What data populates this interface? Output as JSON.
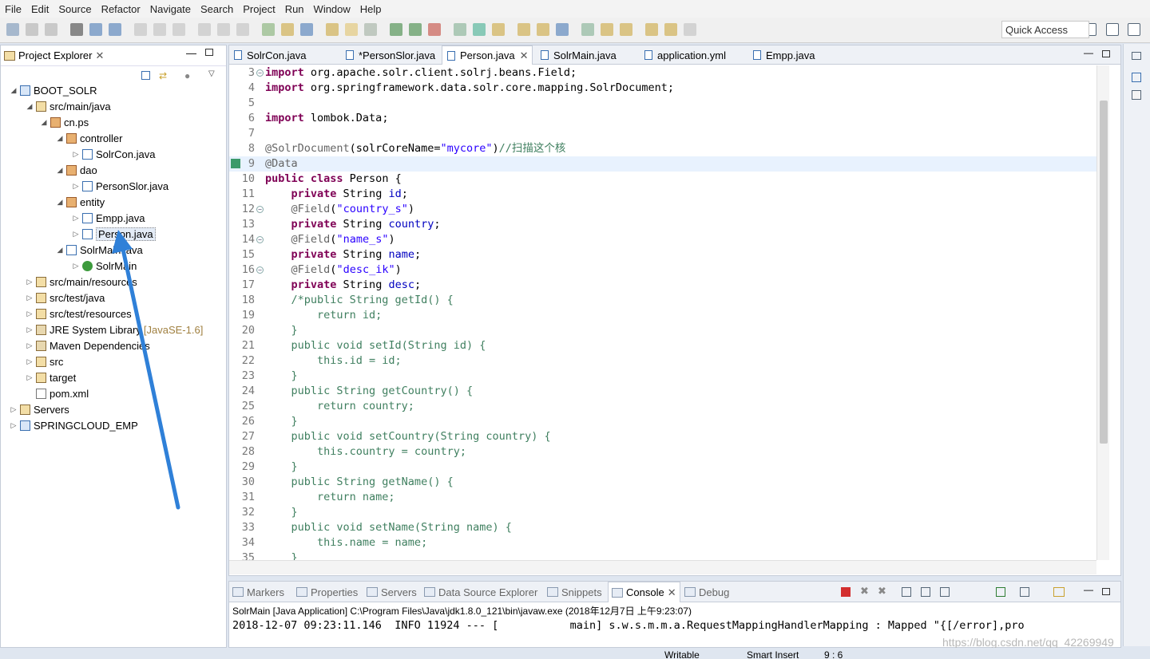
{
  "menu": [
    "File",
    "Edit",
    "Source",
    "Refactor",
    "Navigate",
    "Search",
    "Project",
    "Run",
    "Window",
    "Help"
  ],
  "toolbar": {
    "quick_access": "Quick Access"
  },
  "project_explorer": {
    "title": "Project Explorer",
    "tree": [
      {
        "label": "BOOT_SOLR",
        "icon": "project-icon",
        "twisty": "◢"
      },
      {
        "label": "src/main/java",
        "icon": "source-folder-icon",
        "twisty": "◢"
      },
      {
        "label": "cn.ps",
        "icon": "package-icon",
        "twisty": "◢"
      },
      {
        "label": "controller",
        "icon": "package-icon",
        "twisty": "◢"
      },
      {
        "label": "SolrCon.java",
        "icon": "java-file-icon",
        "twisty": "▷"
      },
      {
        "label": "dao",
        "icon": "package-icon",
        "twisty": "◢"
      },
      {
        "label": "PersonSlor.java",
        "icon": "java-file-icon",
        "twisty": "▷"
      },
      {
        "label": "entity",
        "icon": "package-icon",
        "twisty": "◢"
      },
      {
        "label": "Empp.java",
        "icon": "java-file-icon",
        "twisty": "▷"
      },
      {
        "label": "Person.java",
        "icon": "java-file-icon",
        "twisty": "▷"
      },
      {
        "label": "SolrMain.java",
        "icon": "java-file-icon",
        "twisty": "◢"
      },
      {
        "label": "SolrMain",
        "icon": "class-icon",
        "twisty": "▷"
      },
      {
        "label": "src/main/resources",
        "icon": "source-folder-icon",
        "twisty": "▷"
      },
      {
        "label": "src/test/java",
        "icon": "source-folder-icon",
        "twisty": "▷"
      },
      {
        "label": "src/test/resources",
        "icon": "source-folder-icon",
        "twisty": "▷"
      },
      {
        "label": "JRE System Library",
        "icon": "library-icon",
        "twisty": "▷",
        "deco": "[JavaSE-1.6]"
      },
      {
        "label": "Maven Dependencies",
        "icon": "library-icon",
        "twisty": "▷"
      },
      {
        "label": "src",
        "icon": "folder-icon",
        "twisty": "▷"
      },
      {
        "label": "target",
        "icon": "folder-icon",
        "twisty": "▷"
      },
      {
        "label": "pom.xml",
        "icon": "xml-file-icon",
        "twisty": ""
      },
      {
        "label": "Servers",
        "icon": "folder-icon",
        "twisty": "▷"
      },
      {
        "label": "SPRINGCLOUD_EMP",
        "icon": "project-icon",
        "twisty": "▷"
      }
    ]
  },
  "editor": {
    "tabs": [
      "SolrCon.java",
      "*PersonSlor.java",
      "Person.java",
      "SolrMain.java",
      "application.yml",
      "Empp.java"
    ],
    "active_tab": "Person.java",
    "lines": [
      {
        "n": "3",
        "html": "<span class=\"kw\">import</span> org.apache.solr.client.solrj.beans.Field;"
      },
      {
        "n": "4",
        "html": "<span class=\"kw\">import</span> org.springframework.data.solr.core.mapping.SolrDocument;"
      },
      {
        "n": "5",
        "html": ""
      },
      {
        "n": "6",
        "html": "<span class=\"kw\">import</span> lombok.Data;"
      },
      {
        "n": "7",
        "html": ""
      },
      {
        "n": "8",
        "html": "<span class=\"ann\">@SolrDocument</span>(solrCoreName=<span class=\"str\">\"mycore\"</span>)<span class=\"cmt\">//扫描这个核</span>"
      },
      {
        "n": "9",
        "html": "<span class=\"ann\">@Data</span>"
      },
      {
        "n": "10",
        "html": "<span class=\"kw\">public class</span> Person {"
      },
      {
        "n": "11",
        "html": "    <span class=\"kw\">private</span> String <span class=\"fld\">id</span>;"
      },
      {
        "n": "12",
        "html": "    <span class=\"ann\">@Field</span>(<span class=\"str\">\"country_s\"</span>)"
      },
      {
        "n": "13",
        "html": "    <span class=\"kw\">private</span> String <span class=\"fld\">country</span>;"
      },
      {
        "n": "14",
        "html": "    <span class=\"ann\">@Field</span>(<span class=\"str\">\"name_s\"</span>)"
      },
      {
        "n": "15",
        "html": "    <span class=\"kw\">private</span> String <span class=\"fld\">name</span>;"
      },
      {
        "n": "16",
        "html": "    <span class=\"ann\">@Field</span>(<span class=\"str\">\"desc_ik\"</span>)"
      },
      {
        "n": "17",
        "html": "    <span class=\"kw\">private</span> String <span class=\"fld\">desc</span>;"
      },
      {
        "n": "18",
        "html": "    <span class=\"cmt\">/*public String getId() {</span>"
      },
      {
        "n": "19",
        "html": "<span class=\"cmt\">        return id;</span>"
      },
      {
        "n": "20",
        "html": "<span class=\"cmt\">    }</span>"
      },
      {
        "n": "21",
        "html": "<span class=\"cmt\">    public void setId(String id) {</span>"
      },
      {
        "n": "22",
        "html": "<span class=\"cmt\">        this.id = id;</span>"
      },
      {
        "n": "23",
        "html": "<span class=\"cmt\">    }</span>"
      },
      {
        "n": "24",
        "html": "<span class=\"cmt\">    public String getCountry() {</span>"
      },
      {
        "n": "25",
        "html": "<span class=\"cmt\">        return country;</span>"
      },
      {
        "n": "26",
        "html": "<span class=\"cmt\">    }</span>"
      },
      {
        "n": "27",
        "html": "<span class=\"cmt\">    public void setCountry(String country) {</span>"
      },
      {
        "n": "28",
        "html": "<span class=\"cmt\">        this.country = country;</span>"
      },
      {
        "n": "29",
        "html": "<span class=\"cmt\">    }</span>"
      },
      {
        "n": "30",
        "html": "<span class=\"cmt\">    public String getName() {</span>"
      },
      {
        "n": "31",
        "html": "<span class=\"cmt\">        return name;</span>"
      },
      {
        "n": "32",
        "html": "<span class=\"cmt\">    }</span>"
      },
      {
        "n": "33",
        "html": "<span class=\"cmt\">    public void setName(String name) {</span>"
      },
      {
        "n": "34",
        "html": "<span class=\"cmt\">        this.name = name;</span>"
      },
      {
        "n": "35",
        "html": "<span class=\"cmt\">    }</span>"
      }
    ]
  },
  "console": {
    "tabs": [
      "Markers",
      "Properties",
      "Servers",
      "Data Source Explorer",
      "Snippets",
      "Console",
      "Debug"
    ],
    "active_tab": "Console",
    "launch": "SolrMain [Java Application] C:\\Program Files\\Java\\jdk1.8.0_121\\bin\\javaw.exe (2018年12月7日 上午9:23:07)",
    "log": "2018-12-07 09:23:11.146  INFO 11924 --- [           main] s.w.s.m.m.a.RequestMappingHandlerMapping : Mapped \"{[/error],pro"
  },
  "status": {
    "writable": "Writable",
    "insert": "Smart Insert",
    "position": "9 : 6"
  },
  "watermark": "https://blog.csdn.net/qq_42269949"
}
